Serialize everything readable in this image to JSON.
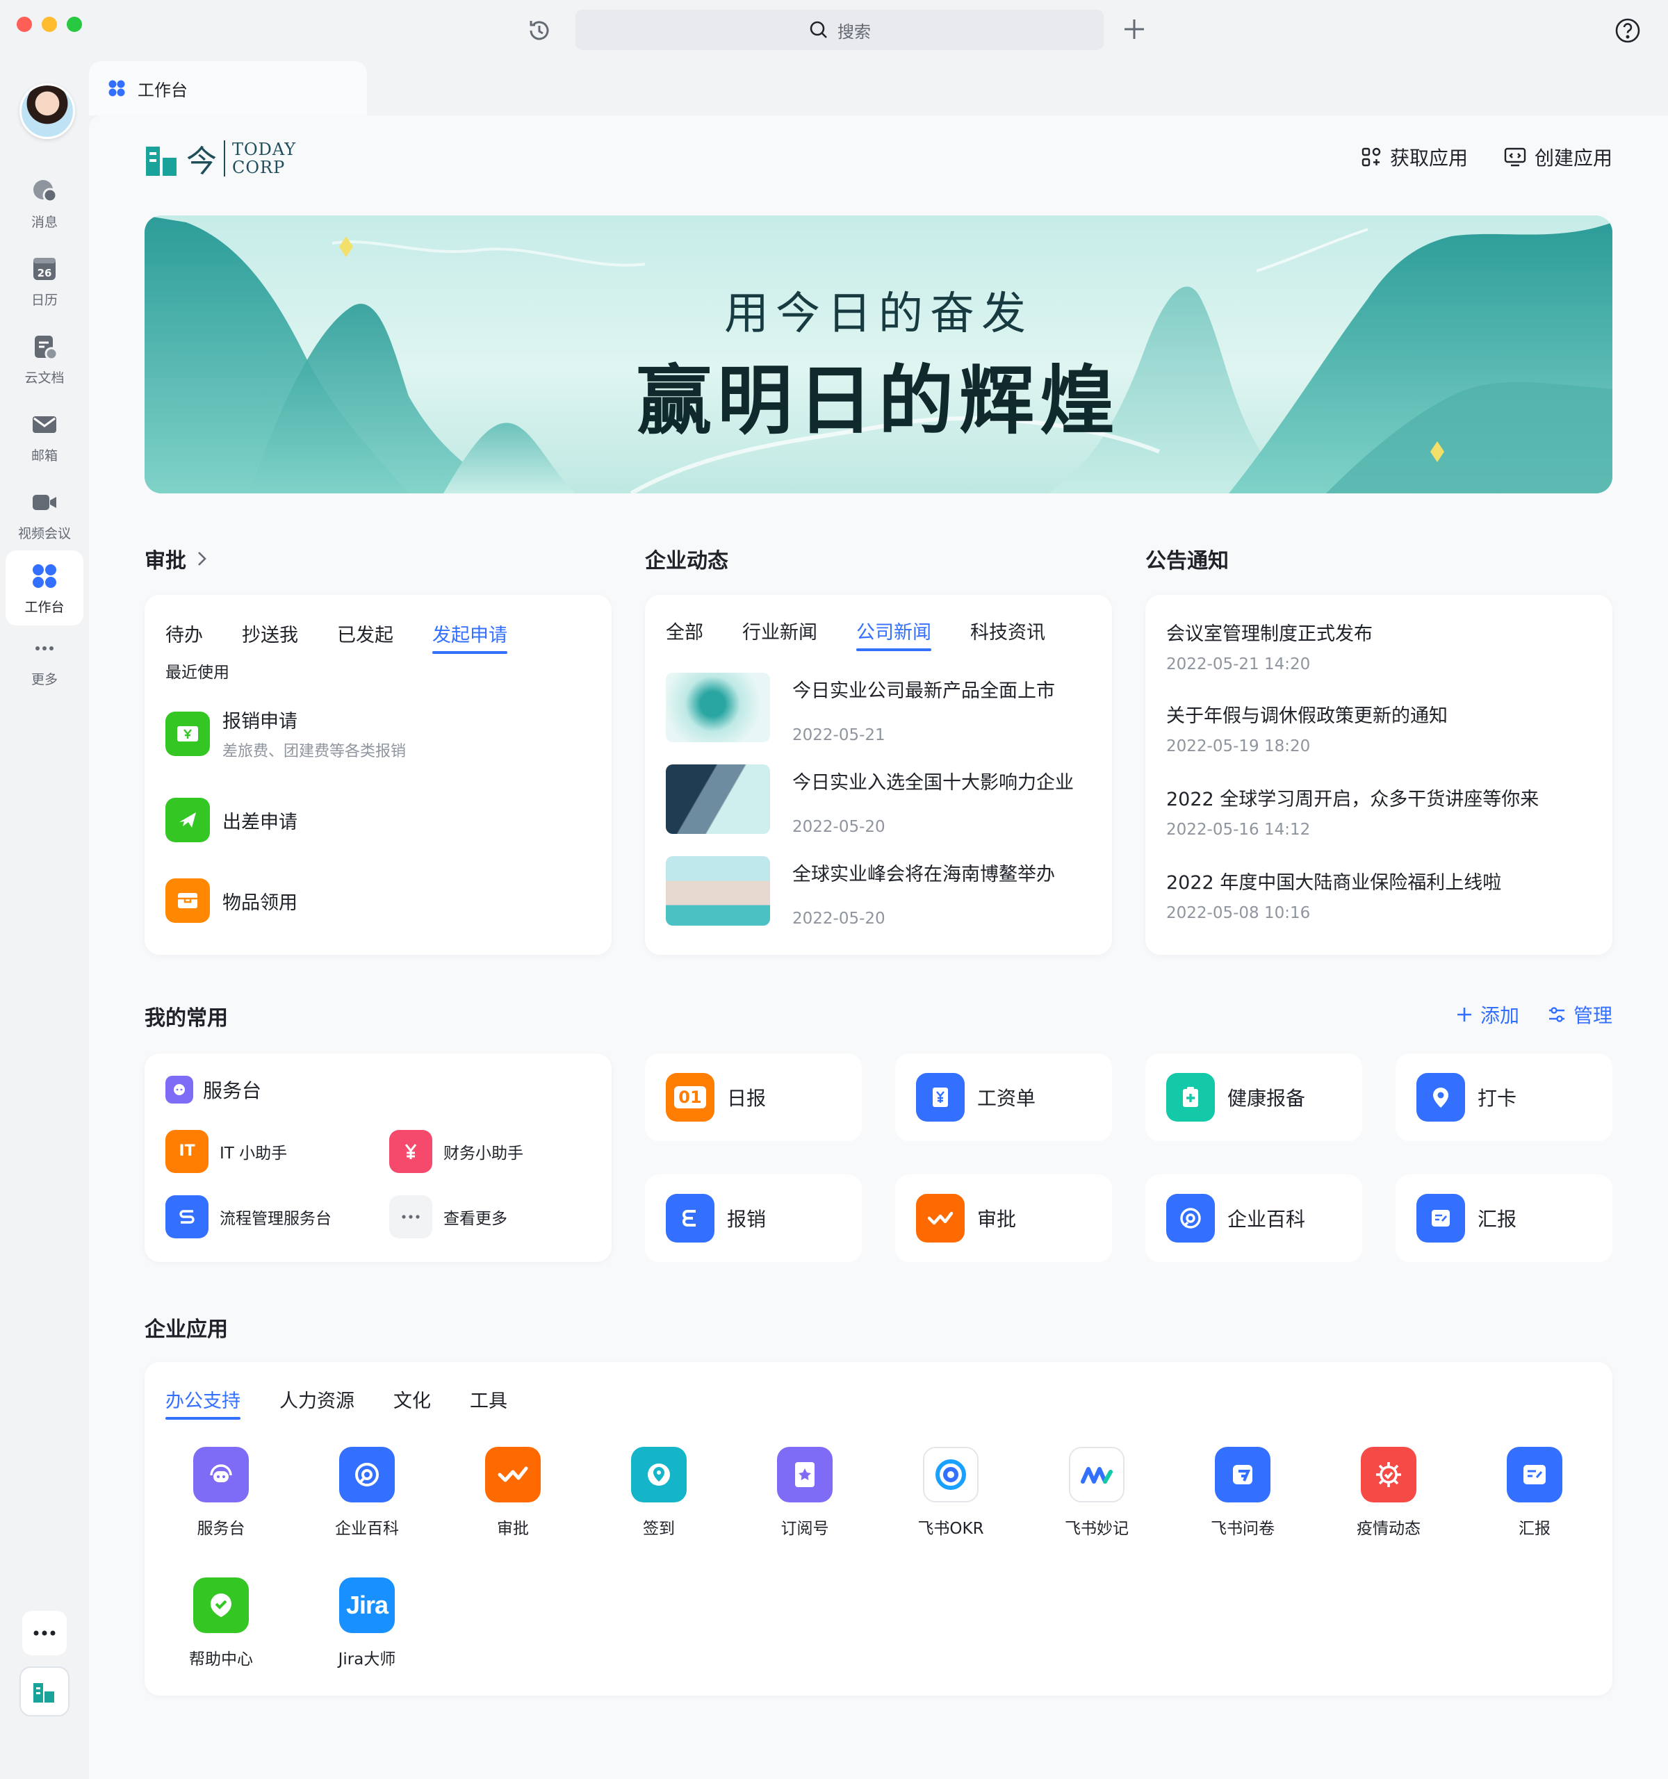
{
  "topbar": {
    "search_placeholder": "搜索"
  },
  "rail": {
    "items": [
      {
        "label": "消息"
      },
      {
        "label": "日历",
        "day": "26"
      },
      {
        "label": "云文档"
      },
      {
        "label": "邮箱"
      },
      {
        "label": "视频会议"
      },
      {
        "label": "工作台"
      },
      {
        "label": "更多"
      }
    ]
  },
  "tab": {
    "title": "工作台"
  },
  "brand": {
    "char": "今",
    "line1": "TODAY",
    "line2": "CORP"
  },
  "actions": {
    "get_app": "获取应用",
    "create_app": "创建应用"
  },
  "banner": {
    "line1": "用今日的奋发",
    "line2": "赢明日的辉煌"
  },
  "approval": {
    "title": "审批",
    "tabs": [
      "待办",
      "抄送我",
      "已发起",
      "发起申请"
    ],
    "recent_label": "最近使用",
    "items": [
      {
        "title": "报销申请",
        "sub": "差旅费、团建费等各类报销"
      },
      {
        "title": "出差申请"
      },
      {
        "title": "物品领用"
      }
    ]
  },
  "news": {
    "title": "企业动态",
    "tabs": [
      "全部",
      "行业新闻",
      "公司新闻",
      "科技资讯"
    ],
    "items": [
      {
        "title": "今日实业公司最新产品全面上市",
        "date": "2022-05-21"
      },
      {
        "title": "今日实业入选全国十大影响力企业",
        "date": "2022-05-20"
      },
      {
        "title": "全球实业峰会将在海南博鳌举办",
        "date": "2022-05-20"
      }
    ]
  },
  "notices": {
    "title": "公告通知",
    "items": [
      {
        "title": "会议室管理制度正式发布",
        "date": "2022-05-21 14:20"
      },
      {
        "title": "关于年假与调休假政策更新的通知",
        "date": "2022-05-19 18:20"
      },
      {
        "title": "2022 全球学习周开启，众多干货讲座等你来",
        "date": "2022-05-16  14:12"
      },
      {
        "title": "2022 年度中国大陆商业保险福利上线啦",
        "date": "2022-05-08 10:16"
      }
    ]
  },
  "favorites": {
    "title": "我的常用",
    "add": "添加",
    "manage": "管理",
    "service": {
      "title": "服务台",
      "items": [
        {
          "label": "IT 小助手",
          "badge": "IT"
        },
        {
          "label": "财务小助手"
        },
        {
          "label": "流程管理服务台"
        },
        {
          "label": "查看更多"
        }
      ]
    },
    "cards": [
      {
        "label": "日报",
        "badge": "01"
      },
      {
        "label": "工资单"
      },
      {
        "label": "健康报备"
      },
      {
        "label": "打卡"
      },
      {
        "label": "报销"
      },
      {
        "label": "审批"
      },
      {
        "label": "企业百科"
      },
      {
        "label": "汇报"
      }
    ]
  },
  "enterprise": {
    "title": "企业应用",
    "tabs": [
      "办公支持",
      "人力资源",
      "文化",
      "工具"
    ],
    "apps": [
      {
        "label": "服务台"
      },
      {
        "label": "企业百科"
      },
      {
        "label": "审批"
      },
      {
        "label": "签到"
      },
      {
        "label": "订阅号"
      },
      {
        "label": "飞书OKR"
      },
      {
        "label": "飞书妙记"
      },
      {
        "label": "飞书问卷"
      },
      {
        "label": "疫情动态"
      },
      {
        "label": "汇报"
      },
      {
        "label": "帮助中心"
      },
      {
        "label": "Jira大师",
        "badge": "Jira"
      }
    ]
  },
  "colors": {
    "accent": "#3370ff",
    "green": "#34c724",
    "orange": "#ff7d00",
    "teal": "#14c9a8",
    "purple": "#7f6cf6",
    "red": "#f54a45"
  }
}
